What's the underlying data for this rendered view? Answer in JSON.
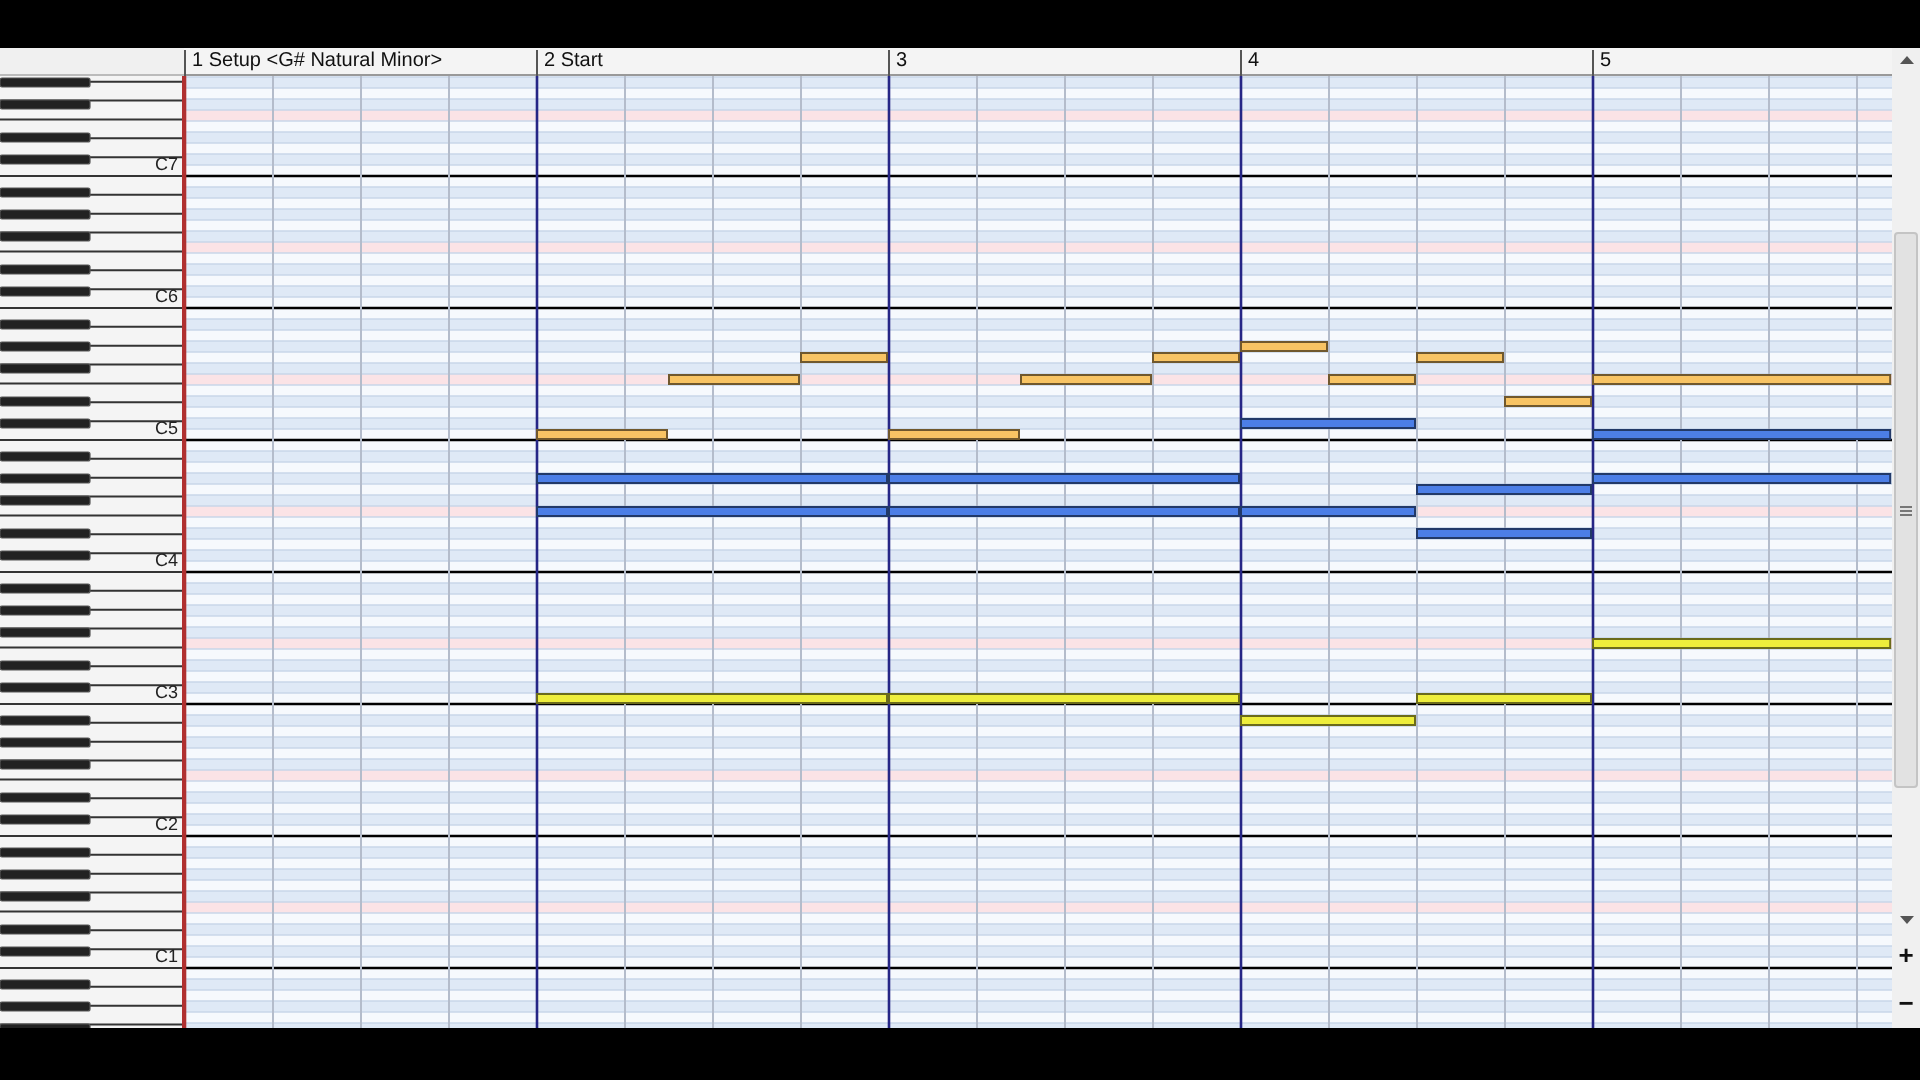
{
  "measures": [
    {
      "number": "1",
      "label": "Setup <G# Natural Minor>"
    },
    {
      "number": "2",
      "label": "Start"
    },
    {
      "number": "3"
    },
    {
      "number": "4"
    },
    {
      "number": "5"
    }
  ],
  "keyboard": {
    "octave_labels": [
      "C7",
      "C6",
      "C5",
      "C4",
      "C3",
      "C2",
      "C1"
    ]
  },
  "tracks": [
    {
      "color": "#f8c464"
    },
    {
      "color": "#4c7ee6"
    },
    {
      "color": "#eeee3c"
    }
  ],
  "zoom_buttons": [
    "+",
    "−"
  ]
}
